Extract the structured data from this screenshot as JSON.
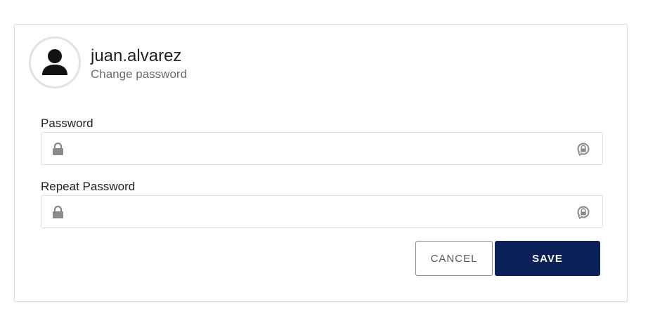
{
  "profile": {
    "username": "juan.alvarez",
    "subtitle": "Change password",
    "avatar_icon": "user-silhouette-icon"
  },
  "fields": [
    {
      "label": "Password",
      "value": "",
      "placeholder": "",
      "leading_icon": "lock-icon",
      "trailing_icon": "reveal-password-icon"
    },
    {
      "label": "Repeat Password",
      "value": "",
      "placeholder": "",
      "leading_icon": "lock-icon",
      "trailing_icon": "reveal-password-icon"
    }
  ],
  "actions": {
    "cancel_label": "CANCEL",
    "save_label": "SAVE"
  },
  "colors": {
    "primary": "#0b2157",
    "border": "#dcdcdc",
    "icon_gray": "#8a8a8a",
    "text": "#222222",
    "muted_text": "#6b6b6b"
  }
}
